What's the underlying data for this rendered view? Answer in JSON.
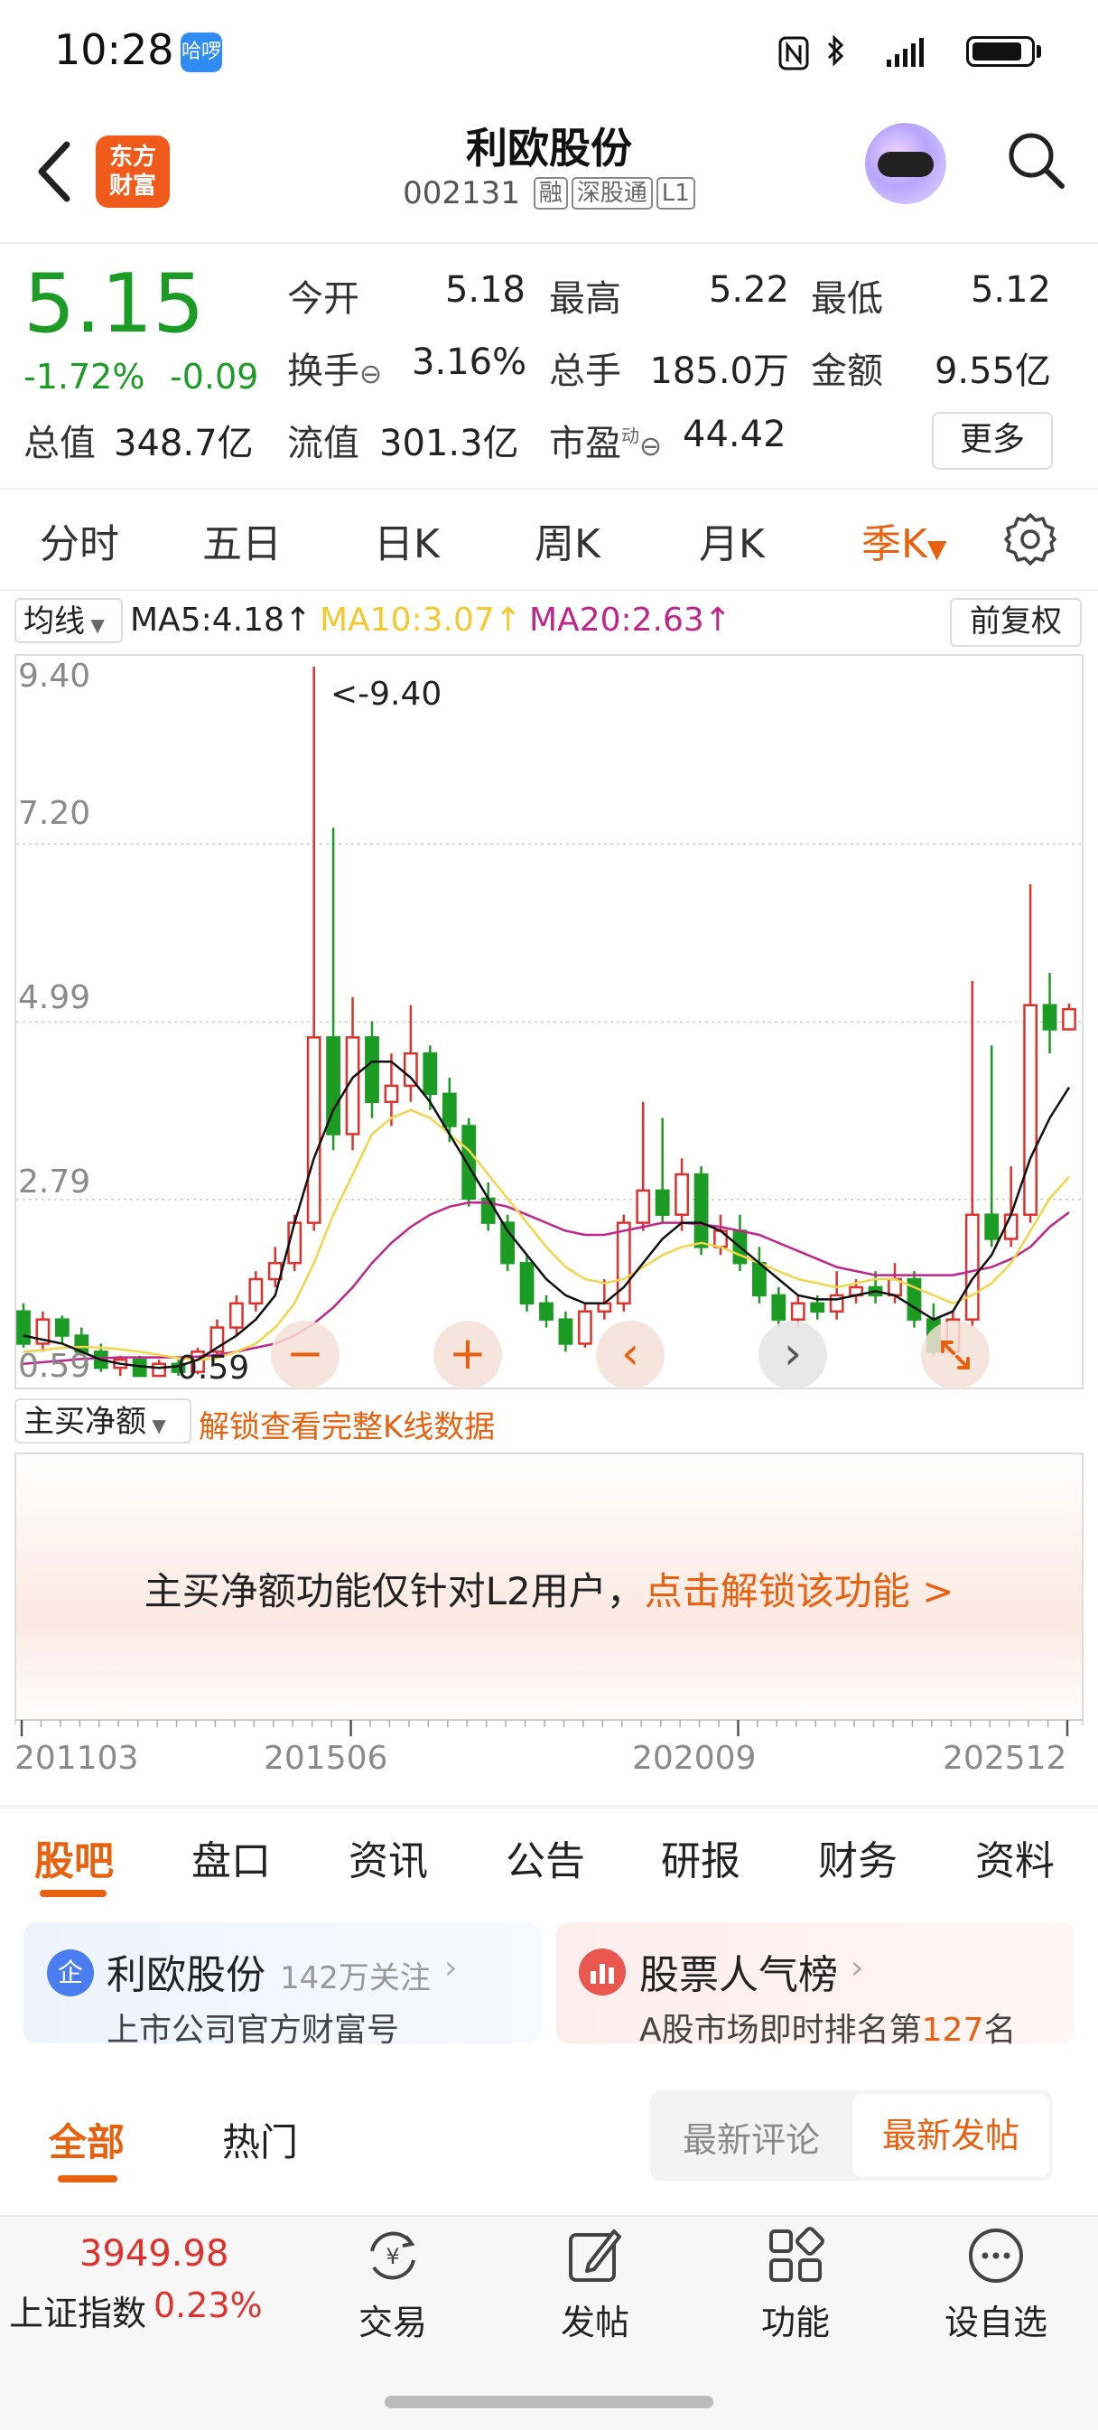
{
  "status_bar": {
    "time": "10:28",
    "badge": "哈啰"
  },
  "header": {
    "logo_line1": "东方",
    "logo_line2": "财富",
    "stock_name": "利欧股份",
    "stock_code": "002131",
    "tags": [
      "融",
      "深股通",
      "L1"
    ]
  },
  "quote": {
    "price": "5.15",
    "change_pct": "-1.72%",
    "change_amt": "-0.09",
    "open_label": "今开",
    "open": "5.18",
    "high_label": "最高",
    "high": "5.22",
    "low_label": "最低",
    "low": "5.12",
    "turnover_label": "换手",
    "turnover": "3.16%",
    "volume_label": "总手",
    "volume": "185.0万",
    "amount_label": "金额",
    "amount": "9.55亿",
    "mktcap_label": "总值",
    "mktcap": "348.7亿",
    "float_label": "流值",
    "float": "301.3亿",
    "pe_label": "市盈",
    "pe_sup": "动",
    "pe": "44.42",
    "more": "更多"
  },
  "period_tabs": [
    "分时",
    "五日",
    "日K",
    "周K",
    "月K",
    "季K"
  ],
  "ma_bar": {
    "select": "均线",
    "ma5": "MA5:4.18↑",
    "ma10": "MA10:3.07↑",
    "ma20": "MA20:2.63↑",
    "adjust": "前复权"
  },
  "colors": {
    "up": "#e0322d",
    "down": "#1c9b25",
    "accent": "#e8610f",
    "ma5": "#111111",
    "ma10": "#f2d64a",
    "ma20": "#c0268a"
  },
  "chart_data": {
    "type": "candlestick",
    "period": "quarterly",
    "y_ticks": [
      "9.40",
      "7.20",
      "4.99",
      "2.79",
      "0.59"
    ],
    "ylim": [
      0.59,
      9.4
    ],
    "x_ticks": [
      "201103",
      "201506",
      "202009",
      "202512"
    ],
    "max_annotation": "<-9.40",
    "min_annotation": "0.59",
    "candles": [
      [
        1.4,
        1.0,
        1.5,
        0.95
      ],
      [
        1.0,
        1.3,
        1.4,
        0.9
      ],
      [
        1.3,
        1.1,
        1.35,
        1.0
      ],
      [
        1.1,
        0.9,
        1.2,
        0.85
      ],
      [
        0.9,
        0.7,
        1.0,
        0.65
      ],
      [
        0.7,
        0.8,
        0.85,
        0.6
      ],
      [
        0.8,
        0.6,
        0.85,
        0.59
      ],
      [
        0.6,
        0.75,
        0.8,
        0.59
      ],
      [
        0.75,
        0.65,
        0.8,
        0.6
      ],
      [
        0.65,
        0.9,
        0.95,
        0.62
      ],
      [
        0.9,
        1.2,
        1.3,
        0.85
      ],
      [
        1.2,
        1.5,
        1.6,
        1.1
      ],
      [
        1.5,
        1.8,
        1.9,
        1.4
      ],
      [
        1.8,
        2.0,
        2.2,
        1.7
      ],
      [
        2.0,
        2.5,
        2.6,
        1.9
      ],
      [
        2.5,
        4.8,
        9.4,
        2.4
      ],
      [
        4.8,
        3.6,
        7.4,
        3.4
      ],
      [
        3.6,
        4.8,
        5.3,
        3.4
      ],
      [
        4.8,
        4.0,
        5.0,
        3.8
      ],
      [
        4.0,
        4.2,
        4.6,
        3.7
      ],
      [
        4.2,
        4.6,
        5.2,
        4.0
      ],
      [
        4.6,
        4.1,
        4.7,
        3.9
      ],
      [
        4.1,
        3.7,
        4.3,
        3.5
      ],
      [
        3.7,
        2.8,
        3.8,
        2.7
      ],
      [
        2.8,
        2.5,
        3.0,
        2.4
      ],
      [
        2.5,
        2.0,
        2.6,
        1.9
      ],
      [
        2.0,
        1.5,
        2.1,
        1.4
      ],
      [
        1.5,
        1.3,
        1.6,
        1.2
      ],
      [
        1.3,
        1.0,
        1.4,
        0.9
      ],
      [
        1.0,
        1.4,
        1.5,
        0.95
      ],
      [
        1.4,
        1.5,
        1.8,
        1.3
      ],
      [
        1.5,
        2.5,
        2.6,
        1.4
      ],
      [
        2.5,
        2.9,
        4.0,
        2.4
      ],
      [
        2.9,
        2.6,
        3.8,
        2.5
      ],
      [
        2.6,
        3.1,
        3.3,
        2.4
      ],
      [
        3.1,
        2.2,
        3.2,
        2.1
      ],
      [
        2.2,
        2.4,
        2.6,
        2.1
      ],
      [
        2.4,
        2.0,
        2.6,
        1.9
      ],
      [
        2.0,
        1.6,
        2.2,
        1.5
      ],
      [
        1.6,
        1.3,
        1.7,
        1.2
      ],
      [
        1.3,
        1.5,
        1.6,
        1.2
      ],
      [
        1.5,
        1.4,
        1.6,
        1.3
      ],
      [
        1.4,
        1.6,
        1.9,
        1.3
      ],
      [
        1.6,
        1.7,
        1.8,
        1.5
      ],
      [
        1.7,
        1.6,
        1.9,
        1.5
      ],
      [
        1.6,
        1.8,
        2.0,
        1.5
      ],
      [
        1.8,
        1.3,
        1.9,
        1.2
      ],
      [
        1.3,
        0.9,
        1.5,
        0.85
      ],
      [
        0.9,
        1.3,
        1.4,
        0.85
      ],
      [
        1.3,
        2.6,
        5.5,
        1.2
      ],
      [
        2.6,
        2.3,
        4.7,
        2.2
      ],
      [
        2.3,
        2.6,
        3.2,
        2.2
      ],
      [
        2.6,
        5.2,
        6.7,
        2.5
      ],
      [
        5.2,
        4.9,
        5.6,
        4.6
      ],
      [
        4.9,
        5.15,
        5.22,
        5.12
      ]
    ],
    "ma5_line": [
      1.1,
      1.05,
      1.0,
      0.9,
      0.8,
      0.75,
      0.72,
      0.7,
      0.72,
      0.8,
      0.95,
      1.1,
      1.3,
      1.6,
      2.5,
      3.3,
      3.9,
      4.3,
      4.5,
      4.5,
      4.3,
      4.0,
      3.6,
      3.2,
      2.8,
      2.4,
      2.1,
      1.8,
      1.6,
      1.5,
      1.5,
      1.7,
      2.0,
      2.3,
      2.5,
      2.5,
      2.4,
      2.2,
      2.0,
      1.8,
      1.6,
      1.55,
      1.55,
      1.6,
      1.65,
      1.6,
      1.45,
      1.3,
      1.4,
      1.8,
      2.1,
      2.6,
      3.3,
      3.8,
      4.18
    ],
    "ma10_line": [
      0.9,
      0.92,
      0.95,
      0.96,
      0.95,
      0.93,
      0.9,
      0.86,
      0.82,
      0.8,
      0.82,
      0.9,
      1.0,
      1.2,
      1.5,
      2.0,
      2.6,
      3.1,
      3.6,
      3.8,
      3.9,
      3.8,
      3.6,
      3.4,
      3.1,
      2.8,
      2.5,
      2.2,
      1.95,
      1.8,
      1.75,
      1.8,
      1.95,
      2.1,
      2.2,
      2.25,
      2.2,
      2.1,
      2.0,
      1.9,
      1.8,
      1.75,
      1.7,
      1.75,
      1.8,
      1.8,
      1.7,
      1.6,
      1.5,
      1.6,
      1.75,
      2.0,
      2.4,
      2.8,
      3.07
    ],
    "ma20_line": [
      0.75,
      0.77,
      0.79,
      0.81,
      0.82,
      0.83,
      0.83,
      0.83,
      0.83,
      0.84,
      0.86,
      0.9,
      0.95,
      1.0,
      1.1,
      1.25,
      1.45,
      1.7,
      2.0,
      2.25,
      2.45,
      2.6,
      2.7,
      2.75,
      2.75,
      2.7,
      2.6,
      2.5,
      2.4,
      2.35,
      2.35,
      2.4,
      2.45,
      2.5,
      2.5,
      2.48,
      2.45,
      2.4,
      2.35,
      2.25,
      2.15,
      2.05,
      1.95,
      1.9,
      1.85,
      1.85,
      1.85,
      1.85,
      1.85,
      1.9,
      1.95,
      2.05,
      2.2,
      2.45,
      2.63
    ]
  },
  "chart_controls": {
    "minus": "−",
    "plus": "+",
    "prev": "‹",
    "next": "›"
  },
  "main_net": {
    "select": "主买净额",
    "unlock_link": "解锁查看完整K线数据",
    "msg_prefix": "主买净额功能仅针对L2用户，",
    "msg_link": "点击解锁该功能 >"
  },
  "bottom_tabs": [
    "股吧",
    "盘口",
    "资讯",
    "公告",
    "研报",
    "财务",
    "资料"
  ],
  "cards": {
    "company_name": "利欧股份",
    "company_follow": "142万关注",
    "company_sub": "上市公司官方财富号",
    "company_badge": "企",
    "rank_title": "股票人气榜",
    "rank_sub_prefix": "A股市场即时排名第",
    "rank_num": "127",
    "rank_sub_suffix": "名"
  },
  "feed_tabs": {
    "all": "全部",
    "hot": "热门",
    "latest_comment": "最新评论",
    "latest_post": "最新发帖"
  },
  "bottom_bar": {
    "index_value": "3949.98",
    "index_name": "上证指数",
    "index_change": "0.23%",
    "trade": "交易",
    "post": "发帖",
    "functions": "功能",
    "watchlist": "设自选"
  }
}
